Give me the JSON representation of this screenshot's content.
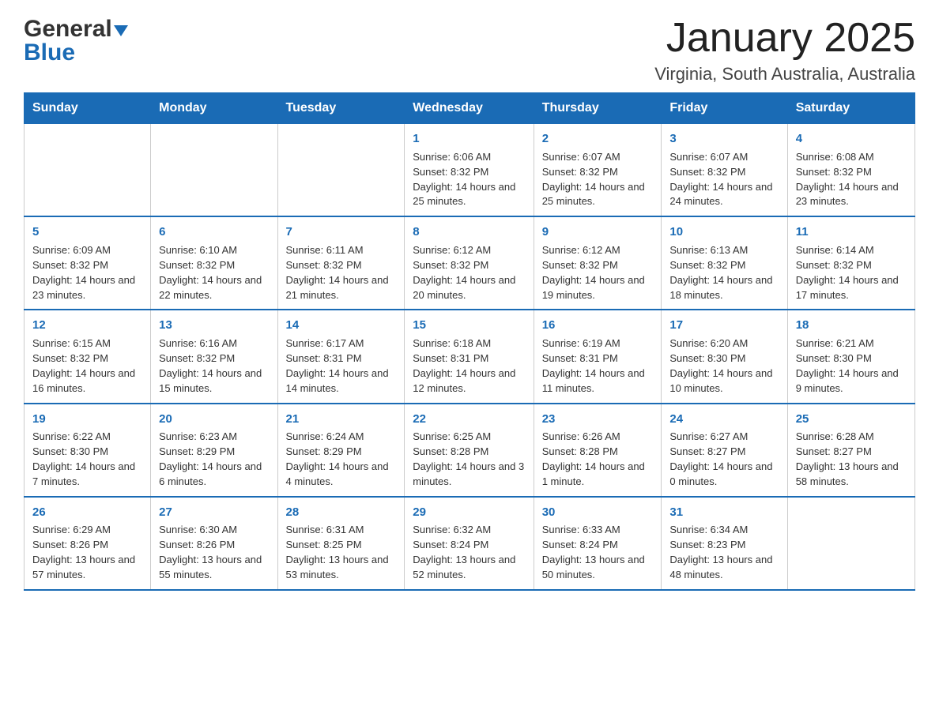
{
  "header": {
    "logo_general": "General",
    "logo_blue": "Blue",
    "month_title": "January 2025",
    "location": "Virginia, South Australia, Australia"
  },
  "days_of_week": [
    "Sunday",
    "Monday",
    "Tuesday",
    "Wednesday",
    "Thursday",
    "Friday",
    "Saturday"
  ],
  "weeks": [
    [
      {
        "day": "",
        "sunrise": "",
        "sunset": "",
        "daylight": ""
      },
      {
        "day": "",
        "sunrise": "",
        "sunset": "",
        "daylight": ""
      },
      {
        "day": "",
        "sunrise": "",
        "sunset": "",
        "daylight": ""
      },
      {
        "day": "1",
        "sunrise": "Sunrise: 6:06 AM",
        "sunset": "Sunset: 8:32 PM",
        "daylight": "Daylight: 14 hours and 25 minutes."
      },
      {
        "day": "2",
        "sunrise": "Sunrise: 6:07 AM",
        "sunset": "Sunset: 8:32 PM",
        "daylight": "Daylight: 14 hours and 25 minutes."
      },
      {
        "day": "3",
        "sunrise": "Sunrise: 6:07 AM",
        "sunset": "Sunset: 8:32 PM",
        "daylight": "Daylight: 14 hours and 24 minutes."
      },
      {
        "day": "4",
        "sunrise": "Sunrise: 6:08 AM",
        "sunset": "Sunset: 8:32 PM",
        "daylight": "Daylight: 14 hours and 23 minutes."
      }
    ],
    [
      {
        "day": "5",
        "sunrise": "Sunrise: 6:09 AM",
        "sunset": "Sunset: 8:32 PM",
        "daylight": "Daylight: 14 hours and 23 minutes."
      },
      {
        "day": "6",
        "sunrise": "Sunrise: 6:10 AM",
        "sunset": "Sunset: 8:32 PM",
        "daylight": "Daylight: 14 hours and 22 minutes."
      },
      {
        "day": "7",
        "sunrise": "Sunrise: 6:11 AM",
        "sunset": "Sunset: 8:32 PM",
        "daylight": "Daylight: 14 hours and 21 minutes."
      },
      {
        "day": "8",
        "sunrise": "Sunrise: 6:12 AM",
        "sunset": "Sunset: 8:32 PM",
        "daylight": "Daylight: 14 hours and 20 minutes."
      },
      {
        "day": "9",
        "sunrise": "Sunrise: 6:12 AM",
        "sunset": "Sunset: 8:32 PM",
        "daylight": "Daylight: 14 hours and 19 minutes."
      },
      {
        "day": "10",
        "sunrise": "Sunrise: 6:13 AM",
        "sunset": "Sunset: 8:32 PM",
        "daylight": "Daylight: 14 hours and 18 minutes."
      },
      {
        "day": "11",
        "sunrise": "Sunrise: 6:14 AM",
        "sunset": "Sunset: 8:32 PM",
        "daylight": "Daylight: 14 hours and 17 minutes."
      }
    ],
    [
      {
        "day": "12",
        "sunrise": "Sunrise: 6:15 AM",
        "sunset": "Sunset: 8:32 PM",
        "daylight": "Daylight: 14 hours and 16 minutes."
      },
      {
        "day": "13",
        "sunrise": "Sunrise: 6:16 AM",
        "sunset": "Sunset: 8:32 PM",
        "daylight": "Daylight: 14 hours and 15 minutes."
      },
      {
        "day": "14",
        "sunrise": "Sunrise: 6:17 AM",
        "sunset": "Sunset: 8:31 PM",
        "daylight": "Daylight: 14 hours and 14 minutes."
      },
      {
        "day": "15",
        "sunrise": "Sunrise: 6:18 AM",
        "sunset": "Sunset: 8:31 PM",
        "daylight": "Daylight: 14 hours and 12 minutes."
      },
      {
        "day": "16",
        "sunrise": "Sunrise: 6:19 AM",
        "sunset": "Sunset: 8:31 PM",
        "daylight": "Daylight: 14 hours and 11 minutes."
      },
      {
        "day": "17",
        "sunrise": "Sunrise: 6:20 AM",
        "sunset": "Sunset: 8:30 PM",
        "daylight": "Daylight: 14 hours and 10 minutes."
      },
      {
        "day": "18",
        "sunrise": "Sunrise: 6:21 AM",
        "sunset": "Sunset: 8:30 PM",
        "daylight": "Daylight: 14 hours and 9 minutes."
      }
    ],
    [
      {
        "day": "19",
        "sunrise": "Sunrise: 6:22 AM",
        "sunset": "Sunset: 8:30 PM",
        "daylight": "Daylight: 14 hours and 7 minutes."
      },
      {
        "day": "20",
        "sunrise": "Sunrise: 6:23 AM",
        "sunset": "Sunset: 8:29 PM",
        "daylight": "Daylight: 14 hours and 6 minutes."
      },
      {
        "day": "21",
        "sunrise": "Sunrise: 6:24 AM",
        "sunset": "Sunset: 8:29 PM",
        "daylight": "Daylight: 14 hours and 4 minutes."
      },
      {
        "day": "22",
        "sunrise": "Sunrise: 6:25 AM",
        "sunset": "Sunset: 8:28 PM",
        "daylight": "Daylight: 14 hours and 3 minutes."
      },
      {
        "day": "23",
        "sunrise": "Sunrise: 6:26 AM",
        "sunset": "Sunset: 8:28 PM",
        "daylight": "Daylight: 14 hours and 1 minute."
      },
      {
        "day": "24",
        "sunrise": "Sunrise: 6:27 AM",
        "sunset": "Sunset: 8:27 PM",
        "daylight": "Daylight: 14 hours and 0 minutes."
      },
      {
        "day": "25",
        "sunrise": "Sunrise: 6:28 AM",
        "sunset": "Sunset: 8:27 PM",
        "daylight": "Daylight: 13 hours and 58 minutes."
      }
    ],
    [
      {
        "day": "26",
        "sunrise": "Sunrise: 6:29 AM",
        "sunset": "Sunset: 8:26 PM",
        "daylight": "Daylight: 13 hours and 57 minutes."
      },
      {
        "day": "27",
        "sunrise": "Sunrise: 6:30 AM",
        "sunset": "Sunset: 8:26 PM",
        "daylight": "Daylight: 13 hours and 55 minutes."
      },
      {
        "day": "28",
        "sunrise": "Sunrise: 6:31 AM",
        "sunset": "Sunset: 8:25 PM",
        "daylight": "Daylight: 13 hours and 53 minutes."
      },
      {
        "day": "29",
        "sunrise": "Sunrise: 6:32 AM",
        "sunset": "Sunset: 8:24 PM",
        "daylight": "Daylight: 13 hours and 52 minutes."
      },
      {
        "day": "30",
        "sunrise": "Sunrise: 6:33 AM",
        "sunset": "Sunset: 8:24 PM",
        "daylight": "Daylight: 13 hours and 50 minutes."
      },
      {
        "day": "31",
        "sunrise": "Sunrise: 6:34 AM",
        "sunset": "Sunset: 8:23 PM",
        "daylight": "Daylight: 13 hours and 48 minutes."
      },
      {
        "day": "",
        "sunrise": "",
        "sunset": "",
        "daylight": ""
      }
    ]
  ]
}
